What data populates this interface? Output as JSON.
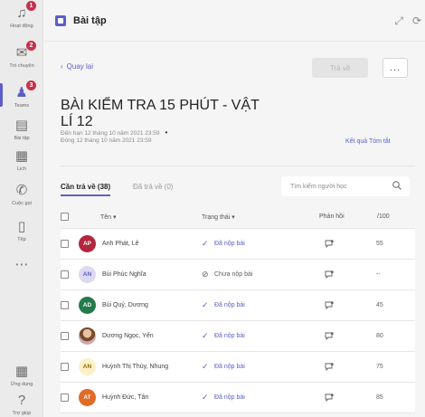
{
  "rail": [
    {
      "label": "Hoạt động",
      "icon": "bell-icon",
      "badge": "1",
      "active": false
    },
    {
      "label": "Trò chuyện",
      "icon": "chat-icon",
      "badge": "2",
      "active": false
    },
    {
      "label": "Teams",
      "icon": "teams-icon",
      "badge": "3",
      "active": true
    },
    {
      "label": "Bài tập",
      "icon": "assignments-icon",
      "badge": "",
      "active": false
    },
    {
      "label": "Lịch",
      "icon": "calendar-icon",
      "badge": "",
      "active": false
    },
    {
      "label": "Cuộc gọi",
      "icon": "phone-icon",
      "badge": "",
      "active": false
    },
    {
      "label": "Tệp",
      "icon": "file-icon",
      "badge": "",
      "active": false
    },
    {
      "label": "...",
      "icon": "more-apps-icon",
      "badge": "",
      "active": false
    },
    {
      "label": "Ứng dụng",
      "icon": "apps-icon",
      "badge": "",
      "active": false
    },
    {
      "label": "Trợ giúp",
      "icon": "help-icon",
      "badge": "",
      "active": false
    }
  ],
  "header": {
    "title": "Bài tập"
  },
  "nav": {
    "back": "Quay lại",
    "return_button": "Trả về",
    "more": "..."
  },
  "assignment": {
    "title": "BÀI KIỂM TRA 15 PHÚT - VẬT LÍ 12",
    "due": "Đến hạn 12 tháng 10 năm 2021 23:59",
    "closes": "Đóng 12 tháng 10 năm 2021 23:59",
    "results_link": "Kết quả Tóm tắt"
  },
  "tabs": {
    "to_return": "Cần trả về (38)",
    "returned": "Đã trả về (0)"
  },
  "search": {
    "placeholder": "Tìm kiếm người học"
  },
  "table": {
    "headers": {
      "name": "Tên",
      "status": "Trạng thái",
      "feedback": "Phản hồi",
      "score": "/100"
    },
    "rows": [
      {
        "initials": "AP",
        "name": "Anh Phát, Lê",
        "status": "Đã nộp bài",
        "submitted": true,
        "score": "55",
        "color": "#b3263e"
      },
      {
        "initials": "AN",
        "name": "Bùi Phúc Nghĩa",
        "status": "Chưa nộp bài",
        "submitted": false,
        "score": "--",
        "color": "#dcd9f0"
      },
      {
        "initials": "AD",
        "name": "Bùi Quý, Dương",
        "status": "Đã nộp bài",
        "submitted": true,
        "score": "45",
        "color": "#237b4b"
      },
      {
        "initials": "",
        "name": "Dương Ngọc, Yến",
        "status": "Đã nộp bài",
        "submitted": true,
        "score": "80",
        "color": "photo"
      },
      {
        "initials": "AN",
        "name": "Huỳnh Thị Thùy, Nhung",
        "status": "Đã nộp bài",
        "submitted": true,
        "score": "75",
        "color": "#fdf0c8"
      },
      {
        "initials": "AT",
        "name": "Huỳnh Đức, Tân",
        "status": "Đã nộp bài",
        "submitted": true,
        "score": "85",
        "color": "#e06a26"
      }
    ]
  }
}
